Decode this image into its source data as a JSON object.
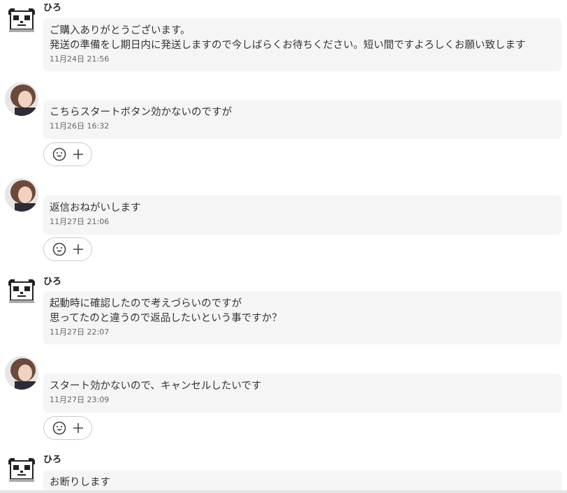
{
  "messages": [
    {
      "sender": "ひろ",
      "avatar_icon": "panda-icon",
      "text": "ご購入ありがとうございます。\n発送の準備をし期日内に発送しますので今しばらくお待ちください。短い間ですよろしくお願い致します",
      "time": "11月24日 21:56"
    },
    {
      "sender": "",
      "avatar_icon": "user-photo-avatar",
      "text": "こちらスタートボタン効かないのですが",
      "time": "11月26日 16:32"
    },
    {
      "sender": "",
      "avatar_icon": "user-photo-avatar",
      "text": "返信おねがいします",
      "time": "11月27日 21:06"
    },
    {
      "sender": "ひろ",
      "avatar_icon": "panda-icon",
      "text": "起動時に確認したので考えづらいのですが\n思ってたのと違うので返品したいという事ですか？",
      "time": "11月27日 22:07"
    },
    {
      "sender": "",
      "avatar_icon": "user-photo-avatar",
      "text": "スタート効かないので、キャンセルしたいです",
      "time": "11月27日 23:09"
    },
    {
      "sender": "ひろ",
      "avatar_icon": "panda-icon",
      "text": "お断りします",
      "time": ""
    }
  ],
  "reaction_icons": [
    "smile-icon",
    "plus-icon"
  ],
  "colors": {
    "bubble_bg": "#f5f5f5",
    "border": "#cccccc",
    "text": "#333333",
    "time": "#666666"
  }
}
